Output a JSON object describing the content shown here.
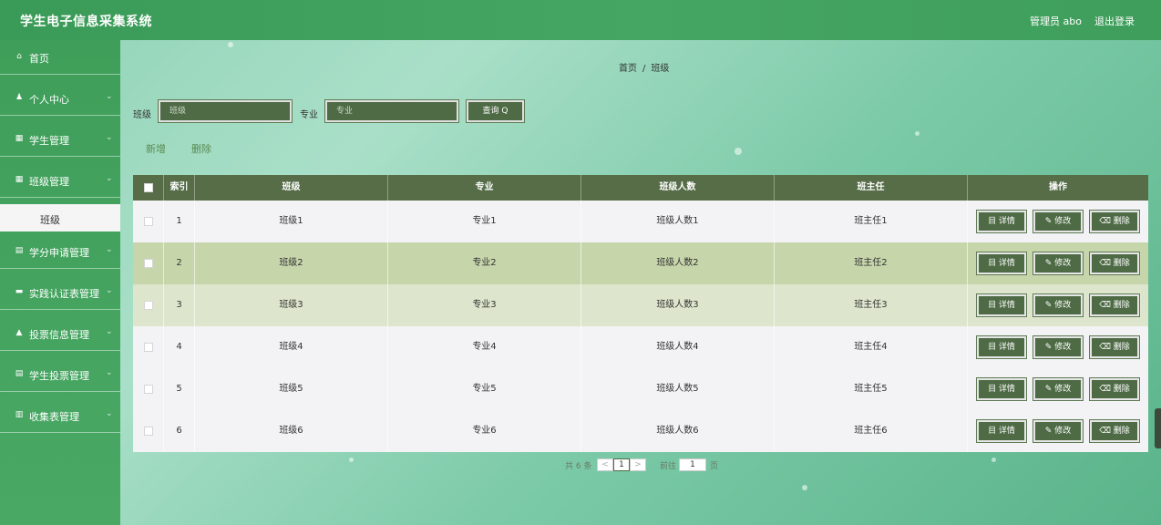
{
  "header": {
    "title": "学生电子信息采集系统",
    "admin": "管理员 abo",
    "logout": "退出登录"
  },
  "sidebar": {
    "items": [
      {
        "icon": "⌂",
        "label": "首页",
        "chevron": ""
      },
      {
        "icon": "♟",
        "label": "个人中心",
        "chevron": "⌄"
      },
      {
        "icon": "▦",
        "label": "学生管理",
        "chevron": "⌄"
      },
      {
        "icon": "▦",
        "label": "班级管理",
        "chevron": "⌄"
      },
      {
        "icon": "▤",
        "label": "学分申请管理",
        "chevron": "⌄"
      },
      {
        "icon": "▬",
        "label": "实践认证表管理",
        "chevron": "⌄"
      },
      {
        "icon": "▲",
        "label": "投票信息管理",
        "chevron": "⌄"
      },
      {
        "icon": "▤",
        "label": "学生投票管理",
        "chevron": "⌄"
      },
      {
        "icon": "▥",
        "label": "收集表管理",
        "chevron": "⌄"
      }
    ],
    "sub_item": "班级"
  },
  "breadcrumb": {
    "home": "首页",
    "sep": "/",
    "current": "班级"
  },
  "search": {
    "class_label": "班级",
    "class_placeholder": "班级",
    "major_label": "专业",
    "major_placeholder": "专业",
    "button": "查询 Q"
  },
  "actions": {
    "add": "新增",
    "delete": "删除"
  },
  "table": {
    "headers": [
      "索引",
      "班级",
      "专业",
      "班级人数",
      "班主任",
      "操作"
    ],
    "ops": {
      "detail": "目 详情",
      "edit": "✎ 修改",
      "remove": "⌫ 删除"
    },
    "rows": [
      {
        "index": "1",
        "class": "班级1",
        "major": "专业1",
        "count": "班级人数1",
        "teacher": "班主任1"
      },
      {
        "index": "2",
        "class": "班级2",
        "major": "专业2",
        "count": "班级人数2",
        "teacher": "班主任2"
      },
      {
        "index": "3",
        "class": "班级3",
        "major": "专业3",
        "count": "班级人数3",
        "teacher": "班主任3"
      },
      {
        "index": "4",
        "class": "班级4",
        "major": "专业4",
        "count": "班级人数4",
        "teacher": "班主任4"
      },
      {
        "index": "5",
        "class": "班级5",
        "major": "专业5",
        "count": "班级人数5",
        "teacher": "班主任5"
      },
      {
        "index": "6",
        "class": "班级6",
        "major": "专业6",
        "count": "班级人数6",
        "teacher": "班主任6"
      }
    ],
    "row_colors": [
      "#f3f2f5",
      "#c7d5ab",
      "#dde6cc",
      "#f3f2f5",
      "#f3f2f5",
      "#f3f2f5"
    ]
  },
  "pagination": {
    "total": "共 6 条",
    "prev": "<",
    "page": "1",
    "next": ">",
    "goto_label": "前往",
    "goto_value": "1",
    "page_suffix": "页"
  }
}
